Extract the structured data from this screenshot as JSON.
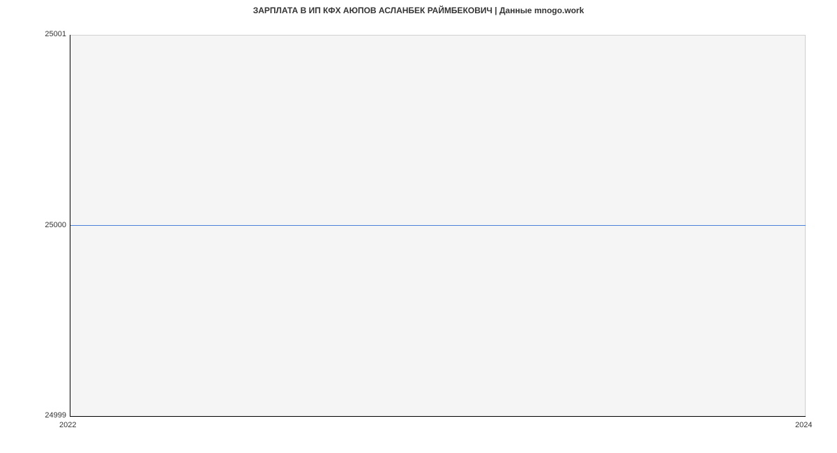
{
  "chart_data": {
    "type": "line",
    "title": "ЗАРПЛАТА В ИП КФХ АЮПОВ АСЛАНБЕК РАЙМБЕКОВИЧ | Данные mnogo.work",
    "x": [
      2022,
      2024
    ],
    "values": [
      25000,
      25000
    ],
    "xlabel": "",
    "ylabel": "",
    "xlim": [
      2022,
      2024
    ],
    "ylim": [
      24999,
      25001
    ],
    "y_ticks": [
      24999,
      25000,
      25001
    ],
    "x_ticks": [
      2022,
      2024
    ],
    "line_color": "#4a7fd8",
    "plot_bgcolor": "#f5f5f5"
  },
  "labels": {
    "title": "ЗАРПЛАТА В ИП КФХ АЮПОВ АСЛАНБЕК РАЙМБЕКОВИЧ | Данные mnogo.work",
    "y_top": "25001",
    "y_mid": "25000",
    "y_bot": "24999",
    "x_left": "2022",
    "x_right": "2024"
  }
}
